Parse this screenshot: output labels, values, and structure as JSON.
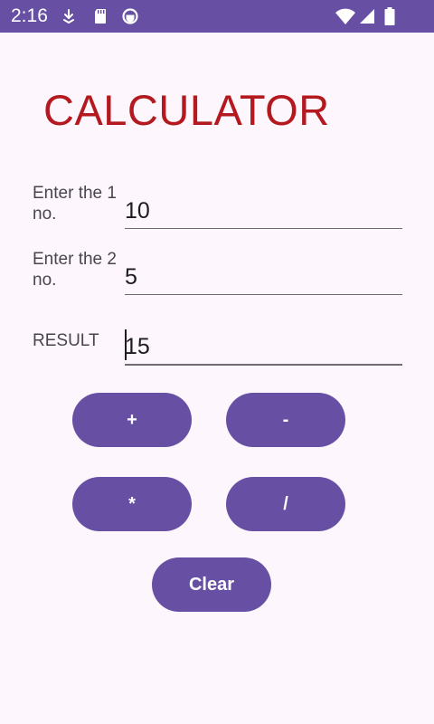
{
  "status_bar": {
    "time": "2:16",
    "icons": [
      "download-icon",
      "sd-card-icon",
      "notification-circle-icon",
      "wifi-icon",
      "cellular-signal-icon",
      "battery-icon"
    ],
    "background_color": "#6750a4"
  },
  "app": {
    "title": "CALCULATOR",
    "title_color": "#b3191f"
  },
  "fields": {
    "first": {
      "label": "Enter the 1 no.",
      "value": "10"
    },
    "second": {
      "label": "Enter the 2 no.",
      "value": "5"
    },
    "result": {
      "label": "RESULT",
      "value": "15"
    }
  },
  "buttons": {
    "add": "+",
    "subtract": "-",
    "multiply": "*",
    "divide": "/",
    "clear": "Clear",
    "color": "#6750a4"
  }
}
